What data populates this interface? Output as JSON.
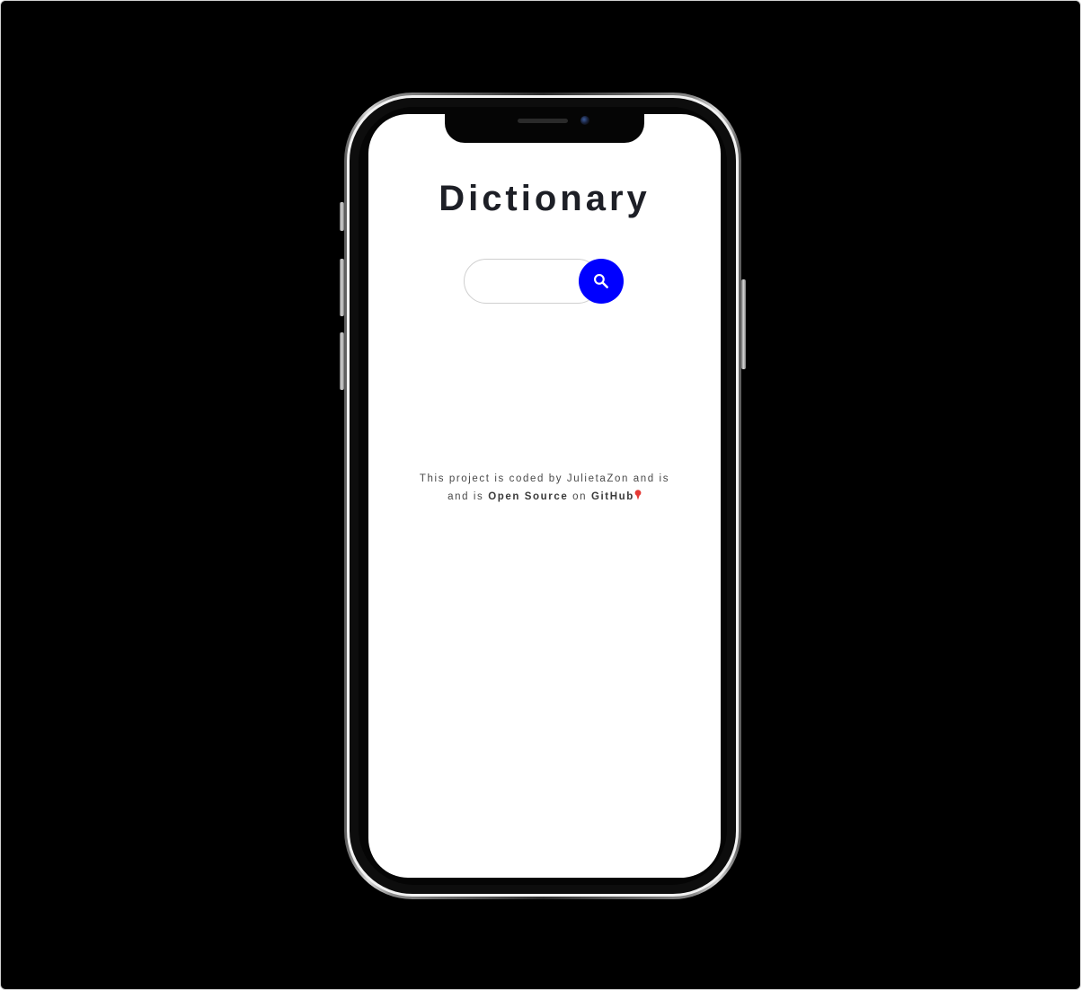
{
  "app": {
    "title": "Dictionary"
  },
  "search": {
    "value": "",
    "placeholder": "",
    "button_icon": "search-icon",
    "button_color": "#0000ff"
  },
  "credits": {
    "line1": "This project is coded by JulietaZon and is",
    "line2_prefix": "and is ",
    "open_source_label": "Open Source",
    "connector": " on ",
    "github_label": "GitHub",
    "trailing_icon": "pin-icon"
  },
  "colors": {
    "background": "#000000",
    "screen": "#ffffff",
    "title": "#1d1f26",
    "accent": "#0000ff"
  }
}
